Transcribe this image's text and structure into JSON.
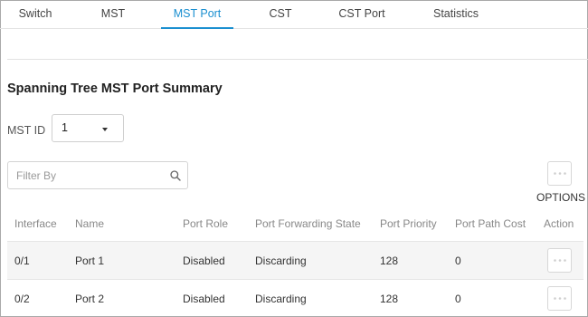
{
  "tabs": [
    {
      "label": "Switch",
      "active": false
    },
    {
      "label": "MST",
      "active": false
    },
    {
      "label": "MST Port",
      "active": true
    },
    {
      "label": "CST",
      "active": false
    },
    {
      "label": "CST Port",
      "active": false
    },
    {
      "label": "Statistics",
      "active": false
    }
  ],
  "page": {
    "title": "Spanning Tree MST Port Summary"
  },
  "mst": {
    "label": "MST ID",
    "selected": "1"
  },
  "filter": {
    "placeholder": "Filter By",
    "icon": "search-icon"
  },
  "options": {
    "label": "OPTIONS",
    "icon": "ellipsis-icon"
  },
  "table": {
    "columns": [
      "Interface",
      "Name",
      "Port Role",
      "Port Forwarding State",
      "Port Priority",
      "Port Path Cost",
      "Action"
    ],
    "rows": [
      {
        "interface": "0/1",
        "name": "Port 1",
        "role": "Disabled",
        "state": "Discarding",
        "priority": "128",
        "cost": "0"
      },
      {
        "interface": "0/2",
        "name": "Port 2",
        "role": "Disabled",
        "state": "Discarding",
        "priority": "128",
        "cost": "0"
      }
    ]
  },
  "colors": {
    "accent": "#1a8fd0",
    "row_shade": "#f5f5f5",
    "muted_text": "#888888"
  }
}
